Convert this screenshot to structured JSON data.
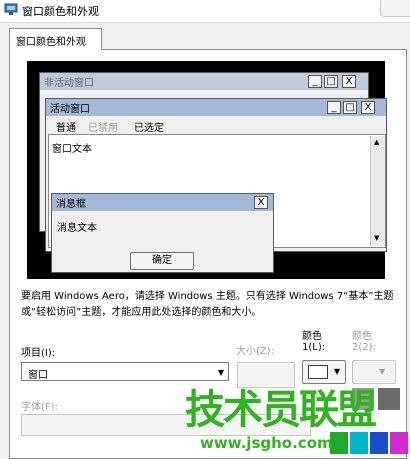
{
  "window": {
    "title": "窗口颜色和外观",
    "tab": "窗口颜色和外观"
  },
  "preview": {
    "inactive_title": "非活动窗口",
    "active_title": "活动窗口",
    "menu": {
      "normal": "普通",
      "disabled": "已禁用",
      "selected": "已选定"
    },
    "window_text": "窗口文本",
    "msgbox_title": "消息框",
    "msgbox_text": "消息文本",
    "ok_label": "确定",
    "close_glyph": "X",
    "min_glyph": "_",
    "max_glyph": "□",
    "scroll_up": "▲",
    "scroll_down": "▼"
  },
  "description": "要启用 Windows Aero，请选择 Windows 主题。只有选择 Windows 7“基本”主题或“轻松访问”主题，才能应用此处选择的颜色和大小。",
  "controls": {
    "item_label": "项目(I):",
    "item_value": "窗口",
    "size_label": "大小(Z):",
    "color1_label_top": "颜色",
    "color1_label": "1(L):",
    "color2_label_top": "颜色",
    "color2_label": "2(2):",
    "font_label": "字体(F):",
    "dropdown_arrow": "▼"
  },
  "watermark": {
    "brand": "技术员联盟",
    "url": "www.jsgho.com"
  },
  "colors": {
    "preview_bg": "#000000",
    "active_title": "#a3b9d8",
    "inactive_title": "#bfcbdc",
    "watermark_green": "#2fb31f"
  }
}
